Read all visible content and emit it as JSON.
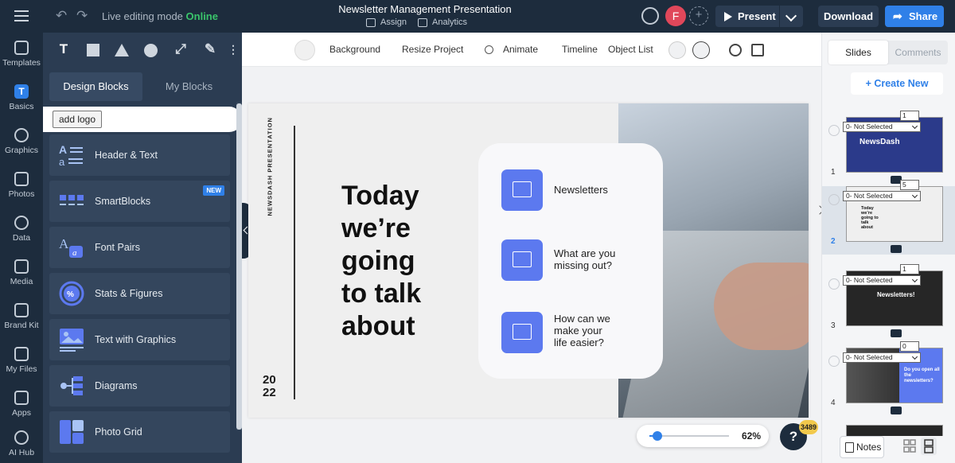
{
  "topbar": {
    "editing_prefix": "Live editing mode",
    "editing_status": "Online",
    "doc_title": "Newsletter Management Presentation",
    "assign_label": "Assign",
    "analytics_label": "Analytics",
    "avatar_letter": "F",
    "add_user": "+",
    "present_label": "Present",
    "download_label": "Download",
    "share_label": "Share"
  },
  "rail": {
    "items": [
      {
        "label": "Templates"
      },
      {
        "label": "Basics",
        "glyph": "T"
      },
      {
        "label": "Graphics"
      },
      {
        "label": "Photos"
      },
      {
        "label": "Data"
      },
      {
        "label": "Media"
      },
      {
        "label": "Brand Kit"
      },
      {
        "label": "My Files"
      },
      {
        "label": "Apps"
      },
      {
        "label": "AI Hub"
      }
    ]
  },
  "panel": {
    "text_tool": "T",
    "tabs": [
      "Design Blocks",
      "My Blocks"
    ],
    "add_logo": "add logo",
    "new_badge": "NEW",
    "blocks": [
      {
        "label": "Header & Text",
        "icon": "header-text-icon"
      },
      {
        "label": "SmartBlocks",
        "icon": "smartblocks-icon"
      },
      {
        "label": "Font Pairs",
        "icon": "font-pairs-icon"
      },
      {
        "label": "Stats & Figures",
        "icon": "stats-icon"
      },
      {
        "label": "Text with Graphics",
        "icon": "text-graphics-icon"
      },
      {
        "label": "Diagrams",
        "icon": "diagrams-icon"
      },
      {
        "label": "Photo Grid",
        "icon": "photo-grid-icon"
      }
    ]
  },
  "canvas_toolbar": {
    "background": "Background",
    "resize": "Resize Project",
    "animate": "Animate",
    "timeline": "Timeline",
    "object_list": "Object List"
  },
  "slide": {
    "vertical_text": "NEWSDASH PRESENTATION",
    "year_top": "20",
    "year_bottom": "22",
    "headline": [
      "Today",
      "we’re",
      "going",
      "to talk",
      "about"
    ],
    "features": [
      [
        "Newsletters"
      ],
      [
        "What are you",
        "missing out?"
      ],
      [
        "How can we",
        "make your",
        "life easier?"
      ]
    ]
  },
  "zoom": {
    "label": "62%",
    "value": 0.1
  },
  "help": {
    "label": "?",
    "badge": "3489"
  },
  "right_panel": {
    "tabs": [
      "Slides",
      "Comments"
    ],
    "create_new": "+ Create New",
    "select_value": "0- Not Selected",
    "thumbs": [
      {
        "num": "1",
        "count": "1",
        "title": "NewsDash"
      },
      {
        "num": "2",
        "count": "5",
        "title": "Today we’re going to talk about"
      },
      {
        "num": "3",
        "count": "1",
        "title": "Newsletters!"
      },
      {
        "num": "4",
        "count": "0",
        "title": "Do you open all the newsletters?"
      }
    ],
    "notes_label": "Notes"
  },
  "colors": {
    "accent": "#2f80e8",
    "feature_icon": "#5c79ef",
    "online": "#3ac46b"
  }
}
